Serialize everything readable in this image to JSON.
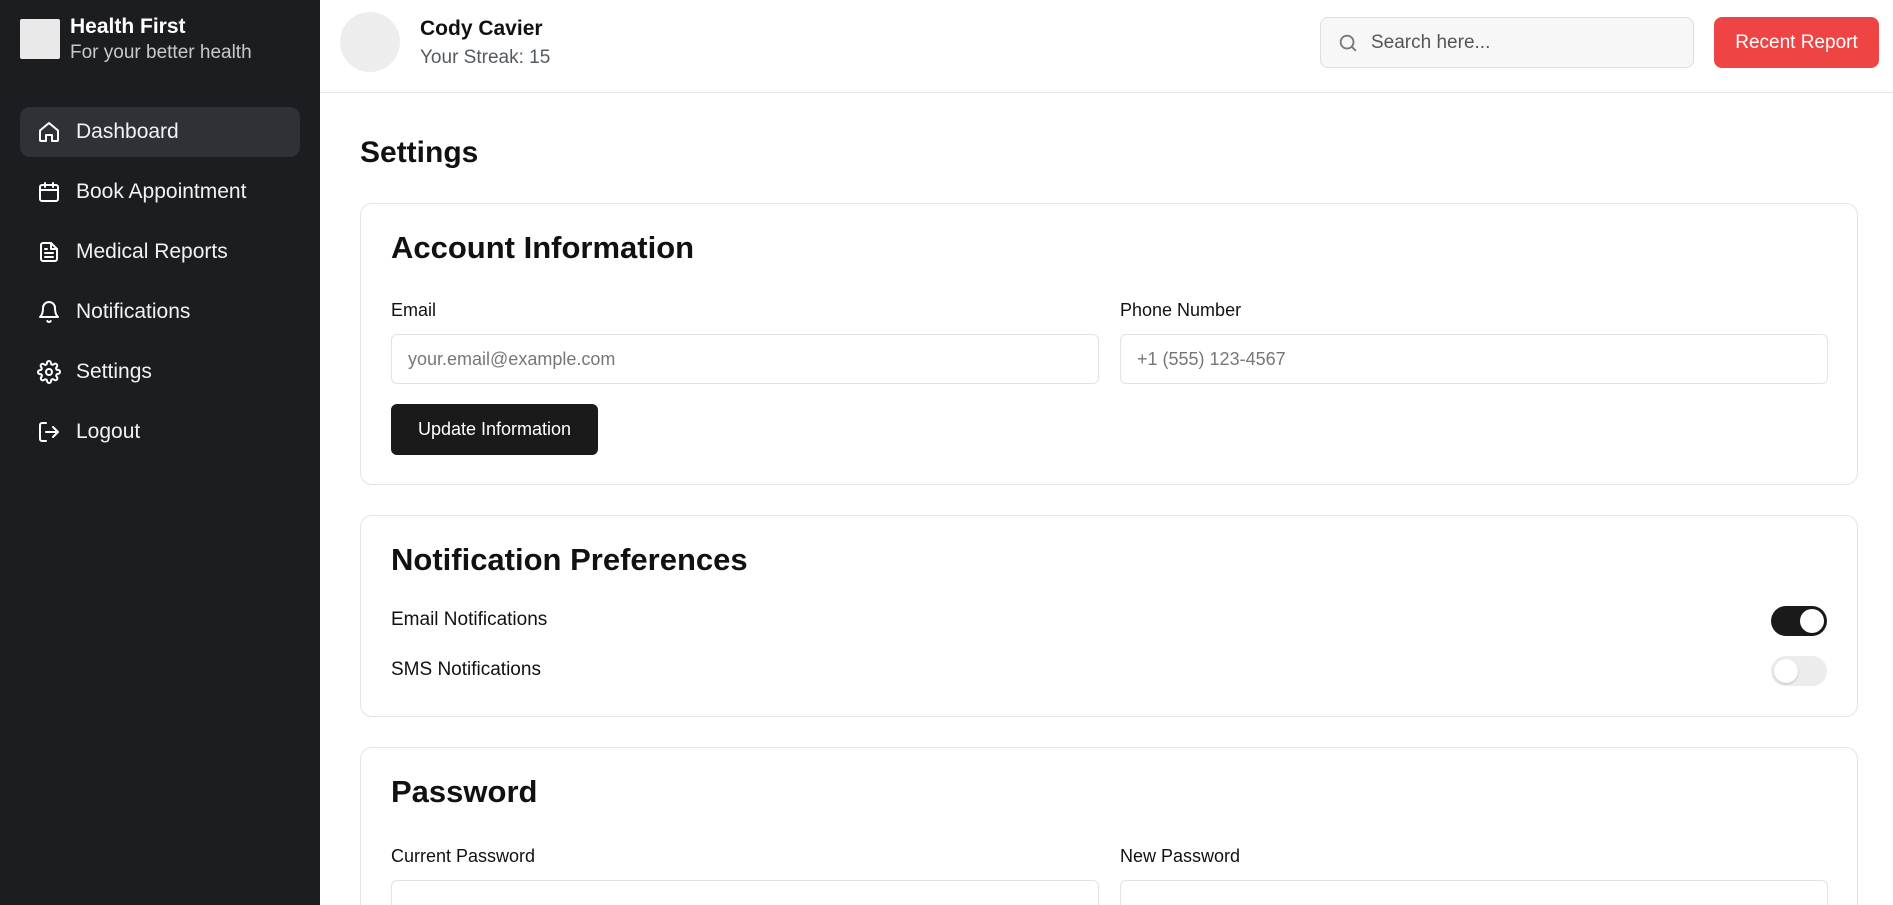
{
  "brand": {
    "title": "Health First",
    "subtitle": "For your better health"
  },
  "sidebar": {
    "items": [
      {
        "label": "Dashboard",
        "icon": "home-icon",
        "active": true
      },
      {
        "label": "Book Appointment",
        "icon": "calendar-icon",
        "active": false
      },
      {
        "label": "Medical Reports",
        "icon": "document-icon",
        "active": false
      },
      {
        "label": "Notifications",
        "icon": "bell-icon",
        "active": false
      },
      {
        "label": "Settings",
        "icon": "gear-icon",
        "active": false
      },
      {
        "label": "Logout",
        "icon": "logout-icon",
        "active": false
      }
    ]
  },
  "header": {
    "user_name": "Cody Cavier",
    "streak": "Your Streak: 15",
    "search_placeholder": "Search here...",
    "recent_report_label": "Recent Report"
  },
  "page": {
    "title": "Settings"
  },
  "account": {
    "title": "Account Information",
    "email_label": "Email",
    "email_placeholder": "your.email@example.com",
    "phone_label": "Phone Number",
    "phone_placeholder": "+1 (555) 123-4567",
    "update_label": "Update Information"
  },
  "notifications": {
    "title": "Notification Preferences",
    "email_label": "Email Notifications",
    "email_enabled": true,
    "sms_label": "SMS Notifications",
    "sms_enabled": false
  },
  "password": {
    "title": "Password",
    "current_label": "Current Password",
    "new_label": "New Password"
  },
  "colors": {
    "sidebar_bg": "#1b1d21",
    "accent_red": "#ef4444",
    "dark_button": "#1a1a1a"
  }
}
